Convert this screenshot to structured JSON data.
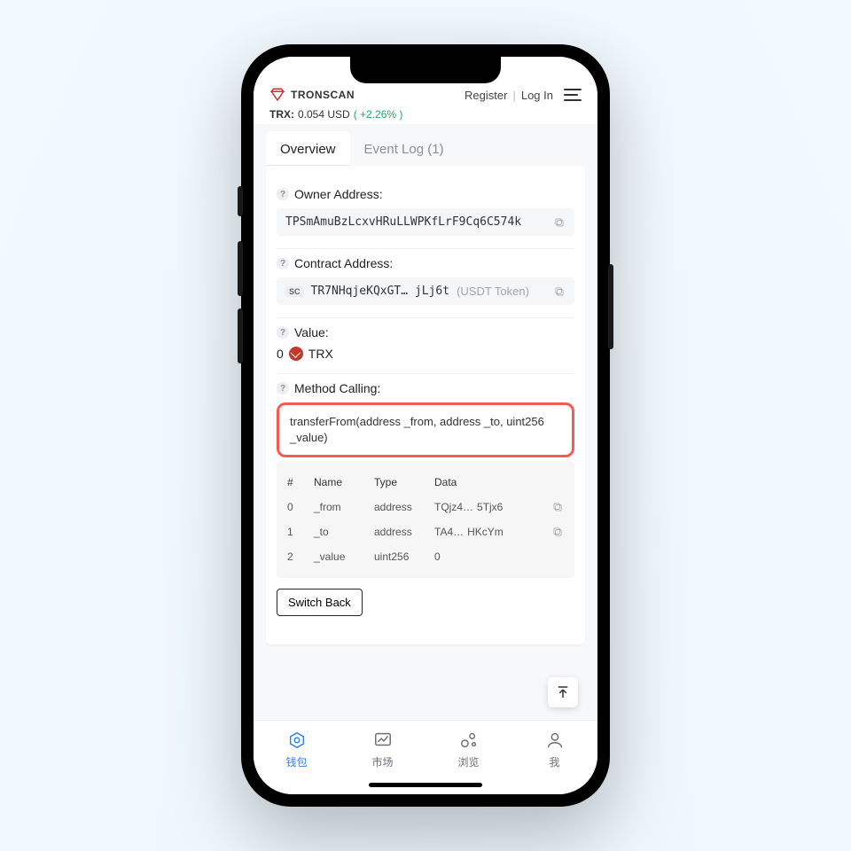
{
  "top": {
    "brand": "TRONSCAN",
    "register": "Register",
    "login": "Log In",
    "ticker": {
      "symbol": "TRX:",
      "price": "0.054 USD",
      "change": "( +2.26% )"
    }
  },
  "tabs": [
    {
      "label": "Overview",
      "active": true
    },
    {
      "label": "Event Log (1)",
      "active": false
    }
  ],
  "owner": {
    "label": "Owner Address:",
    "value": "TPSmAmuBzLcxvHRuLLWPKfLrF9Cq6C574k"
  },
  "contract": {
    "label": "Contract Address:",
    "badge": "SC",
    "value": "TR7NHqjeKQxGT… jLj6t",
    "token": "(USDT Token)"
  },
  "value": {
    "label": "Value:",
    "amount": "0",
    "unit": "TRX"
  },
  "method": {
    "label": "Method Calling:",
    "signature": "transferFrom(address _from, address _to, uint256 _value)",
    "headers": [
      "#",
      "Name",
      "Type",
      "Data"
    ],
    "rows": [
      {
        "idx": "0",
        "name": "_from",
        "type": "address",
        "data_a": "TQjz4…",
        "data_b": "5Tjx6"
      },
      {
        "idx": "1",
        "name": "_to",
        "type": "address",
        "data_a": "TA4…",
        "data_b": "HKcYm"
      },
      {
        "idx": "2",
        "name": "_value",
        "type": "uint256",
        "data_a": "0",
        "data_b": ""
      }
    ],
    "switch": "Switch Back"
  },
  "nav": [
    "钱包",
    "市场",
    "浏览",
    "我"
  ]
}
